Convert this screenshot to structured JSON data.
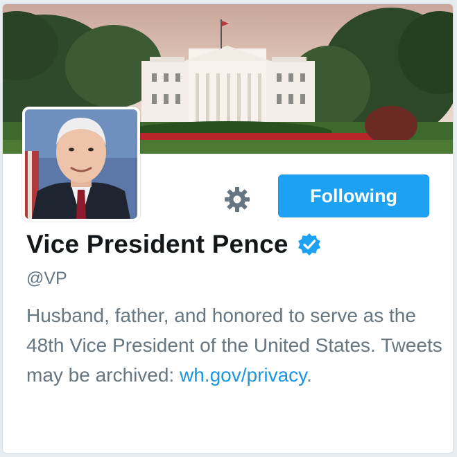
{
  "profile": {
    "name": "Vice President Pence",
    "handle": "@VP",
    "verified": true,
    "verified_icon": "verified-badge-icon",
    "bio_text": "Husband, father, and honored to serve as the 48th Vice President of the United States. Tweets may be archived: ",
    "bio_link": "wh.gov/privacy",
    "bio_end": "."
  },
  "actions": {
    "follow_label": "Following",
    "settings_icon": "gear-icon"
  },
  "colors": {
    "accent": "#1da1f2",
    "link": "#1b95e0",
    "name": "#14171a",
    "secondary": "#657786"
  }
}
